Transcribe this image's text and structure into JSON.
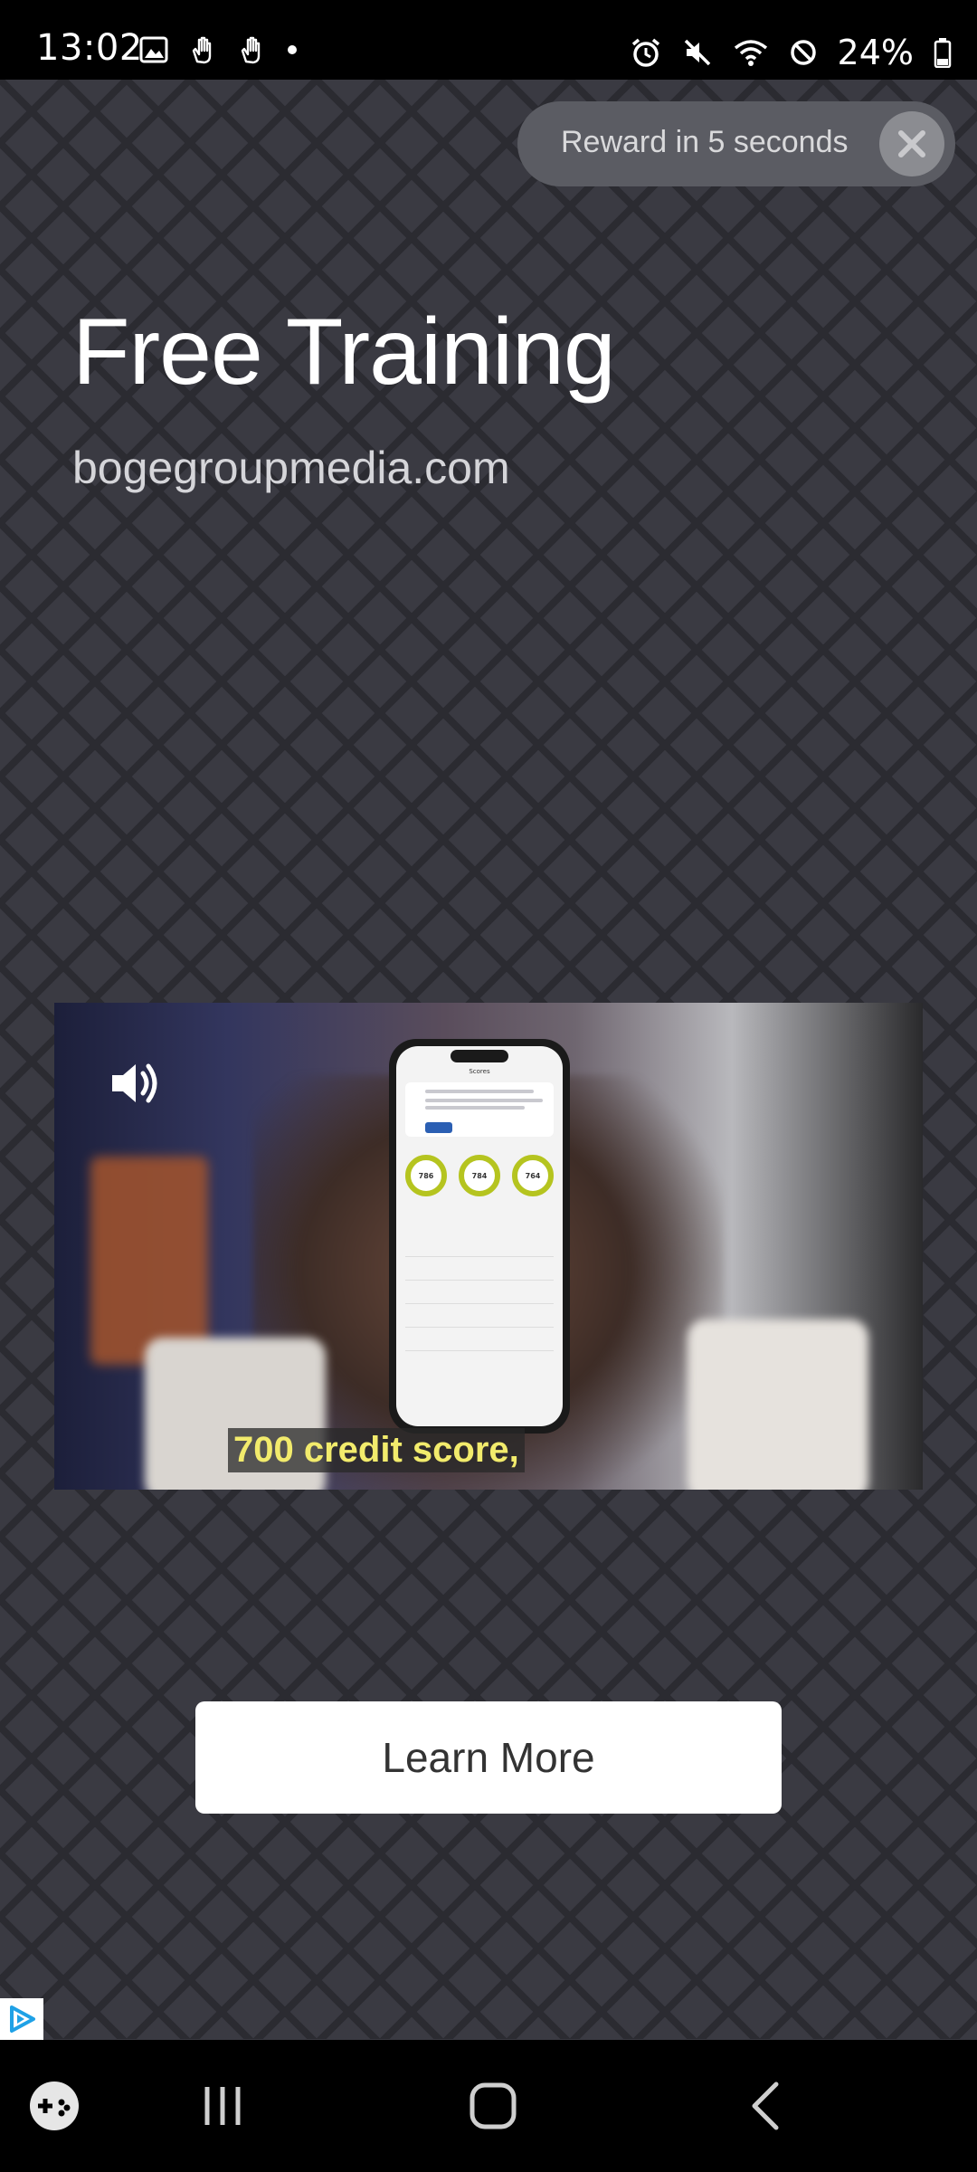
{
  "status_bar": {
    "time": "13:02",
    "battery": "24%",
    "left_icons": [
      "image-icon",
      "hand-icon",
      "hand-icon",
      "dot-icon"
    ],
    "right_icons": [
      "alarm-icon",
      "mute-icon",
      "wifi-icon",
      "block-icon",
      "battery-icon"
    ]
  },
  "ad": {
    "reward_text": "Reward in 5 seconds",
    "headline": "Free Training",
    "domain": "bogegroupmedia.com",
    "cta_label": "Learn More",
    "video_caption": "700 credit score,",
    "phone_screen": {
      "title": "Scores",
      "gauges": [
        "786",
        "784",
        "764"
      ]
    }
  },
  "nav_bar": {
    "items": [
      "game-icon",
      "recents-icon",
      "home-icon",
      "back-icon"
    ]
  },
  "colors": {
    "background": "#3a3a42",
    "caption_text": "#f2eb6c",
    "gauge": "#b5c41f"
  }
}
